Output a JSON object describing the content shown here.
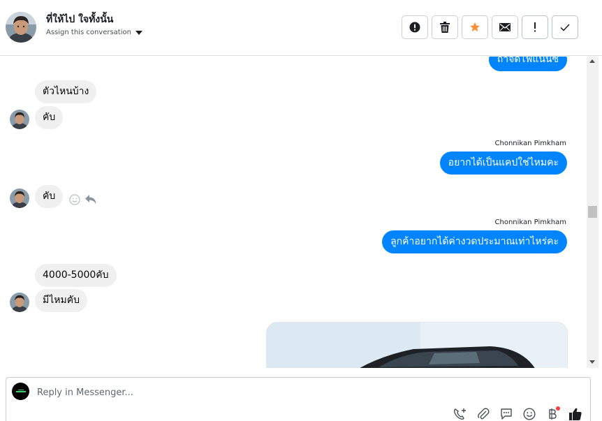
{
  "header": {
    "contact_name": "ที่ให้ไป ใจทั้งนั้น",
    "assign_label": "Assign this conversation",
    "actions": [
      {
        "icon": "alert-circle-icon",
        "label": "Mark as spam"
      },
      {
        "icon": "trash-icon",
        "label": "Delete"
      },
      {
        "icon": "star-icon",
        "label": "Star"
      },
      {
        "icon": "envelope-icon",
        "label": "Mark as unread"
      },
      {
        "icon": "exclamation-icon",
        "label": "Follow up"
      },
      {
        "icon": "check-icon",
        "label": "Mark as done"
      }
    ],
    "star_color": "#f7923b"
  },
  "thread": {
    "partial_top_out": "ถ้าจัดไฟแนนซ์",
    "messages": [
      {
        "dir": "in",
        "text": "ตัวไหนบ้าง"
      },
      {
        "dir": "in",
        "text": "คับ"
      },
      {
        "dir": "out",
        "sender": "Chonnikan Pimkham",
        "text": "อยากได้เป็นแคปใช่ไหมคะ"
      },
      {
        "dir": "in",
        "text": "คับ"
      },
      {
        "dir": "out",
        "sender": "Chonnikan Pimkham",
        "text": "ลูกค้าอยากได้ค่างวดประมาณเท่าไหร่คะ"
      },
      {
        "dir": "in",
        "text": "4000-5000คับ"
      },
      {
        "dir": "in",
        "text": "มีไหมคับ"
      }
    ],
    "out_bubble_color": "#0084ff",
    "in_bubble_color": "#f0f0f0"
  },
  "composer": {
    "placeholder": "Reply in Messenger...",
    "tools": [
      "phone-plus-icon",
      "paperclip-icon",
      "chat-bubble-icon",
      "smiley-icon",
      "baht-icon",
      "thumbs-up-icon"
    ]
  }
}
